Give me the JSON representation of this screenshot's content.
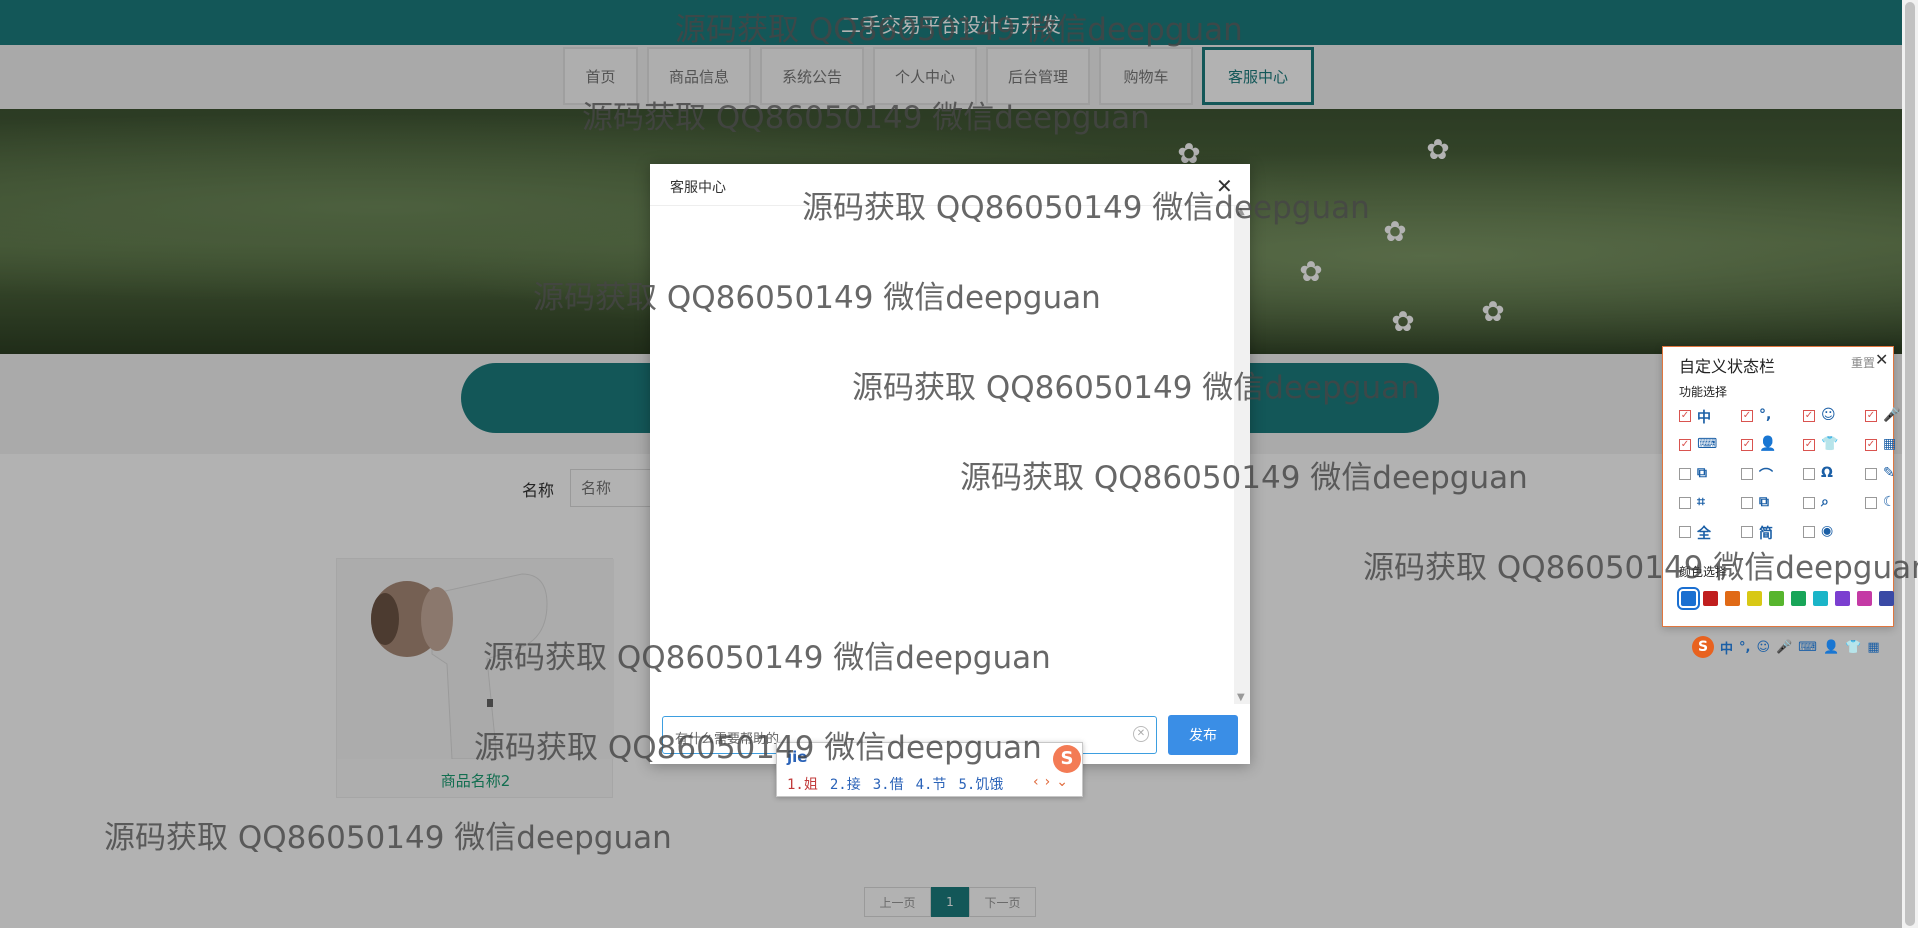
{
  "site": {
    "title": "二手交易平台设计与开发"
  },
  "nav": {
    "items": [
      {
        "label": "首页",
        "width": 75
      },
      {
        "label": "商品信息",
        "width": 104
      },
      {
        "label": "系统公告",
        "width": 104
      },
      {
        "label": "个人中心",
        "width": 104
      },
      {
        "label": "后台管理",
        "width": 104
      },
      {
        "label": "购物车",
        "width": 94
      },
      {
        "label": "客服中心",
        "width": 112,
        "active": true
      }
    ]
  },
  "search": {
    "label": "名称",
    "placeholder": "名称"
  },
  "product": {
    "name": "商品名称2"
  },
  "pager": {
    "prev": "上一页",
    "current": "1",
    "next": "下一页"
  },
  "modal": {
    "title": "客服中心",
    "close_icon": "close-icon",
    "input_value": "有什么需要帮助的",
    "publish_label": "发布"
  },
  "ime": {
    "pinyin": "jie",
    "candidates": [
      "1.姐",
      "2.接",
      "3.借",
      "4.节",
      "5.饥饿"
    ],
    "logo": "S"
  },
  "status_panel": {
    "title": "自定义状态栏",
    "reset": "重置",
    "section_label": "功能选择",
    "colors_label": "颜色选择",
    "items": [
      {
        "icon": "中",
        "checked": true
      },
      {
        "icon": "°,",
        "checked": true
      },
      {
        "icon": "☺",
        "checked": true
      },
      {
        "icon": "🎤",
        "checked": true
      },
      {
        "icon": "⌨",
        "checked": true
      },
      {
        "icon": "👤",
        "checked": true
      },
      {
        "icon": "👕",
        "checked": true
      },
      {
        "icon": "▦",
        "checked": true
      },
      {
        "icon": "⧉",
        "checked": false
      },
      {
        "icon": "⌒",
        "checked": false
      },
      {
        "icon": "Ω",
        "checked": false
      },
      {
        "icon": "✎",
        "checked": false
      },
      {
        "icon": "⌗",
        "checked": false
      },
      {
        "icon": "⧉",
        "checked": false
      },
      {
        "icon": "⌕",
        "checked": false
      },
      {
        "icon": "☾",
        "checked": false
      },
      {
        "icon": "全",
        "checked": false
      },
      {
        "icon": "简",
        "checked": false
      },
      {
        "icon": "◉",
        "checked": false
      }
    ],
    "colors": [
      "#1a6fd1",
      "#c01e1e",
      "#e06a16",
      "#d8c815",
      "#57b52e",
      "#18a558",
      "#1bb5c8",
      "#7b3fd0",
      "#c43aa5",
      "#3a4aa5"
    ],
    "mini_bar": {
      "logo": "S",
      "icons": [
        "中",
        "°,",
        "☺",
        "🎤",
        "⌨",
        "👤",
        "👕",
        "▦"
      ]
    }
  },
  "watermark": {
    "text": "源码获取 QQ86050149 微信deepguan"
  }
}
